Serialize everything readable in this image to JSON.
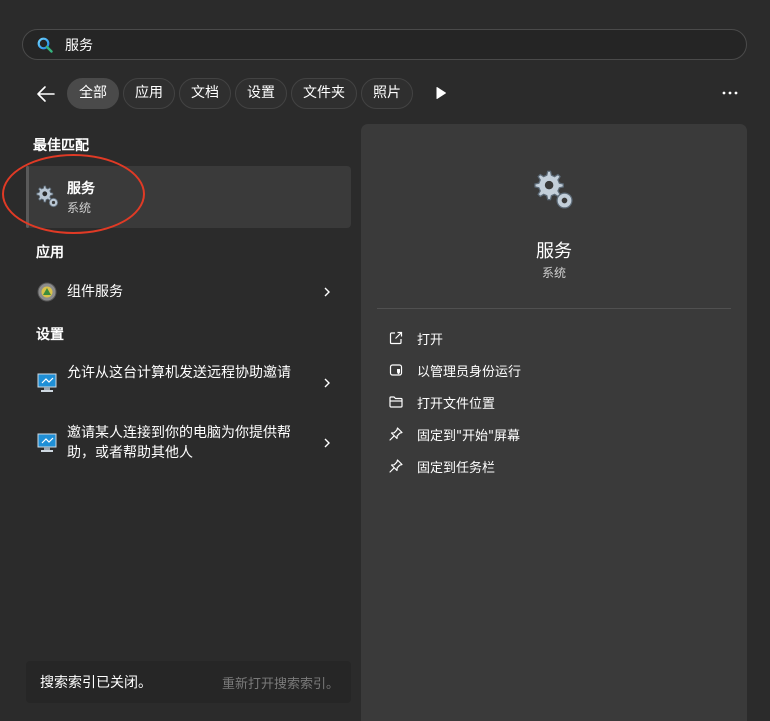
{
  "search": {
    "value": "服务",
    "placeholder": ""
  },
  "filters": {
    "tabs": [
      {
        "label": "全部",
        "active": true
      },
      {
        "label": "应用",
        "active": false
      },
      {
        "label": "文档",
        "active": false
      },
      {
        "label": "设置",
        "active": false
      },
      {
        "label": "文件夹",
        "active": false
      },
      {
        "label": "照片",
        "active": false
      }
    ]
  },
  "results": {
    "best_match_heading": "最佳匹配",
    "best_match": {
      "title": "服务",
      "subtitle": "系统"
    },
    "apps_heading": "应用",
    "apps": [
      {
        "label": "组件服务"
      }
    ],
    "settings_heading": "设置",
    "settings": [
      {
        "label": "允许从这台计算机发送远程协助邀请"
      },
      {
        "label": "邀请某人连接到你的电脑为你提供帮助，或者帮助其他人"
      }
    ]
  },
  "footer": {
    "status": "搜索索引已关闭。",
    "action": "重新打开搜索索引。"
  },
  "detail": {
    "title": "服务",
    "subtitle": "系统",
    "actions": [
      {
        "label": "打开",
        "icon": "open-external-icon"
      },
      {
        "label": "以管理员身份运行",
        "icon": "shield-admin-icon"
      },
      {
        "label": "打开文件位置",
        "icon": "folder-icon"
      },
      {
        "label": "固定到\"开始\"屏幕",
        "icon": "pin-icon"
      },
      {
        "label": "固定到任务栏",
        "icon": "pin-icon"
      }
    ]
  },
  "colors": {
    "background": "#2b2b2b",
    "panel": "#3a3a3a",
    "highlight_circle": "#e03a25"
  }
}
